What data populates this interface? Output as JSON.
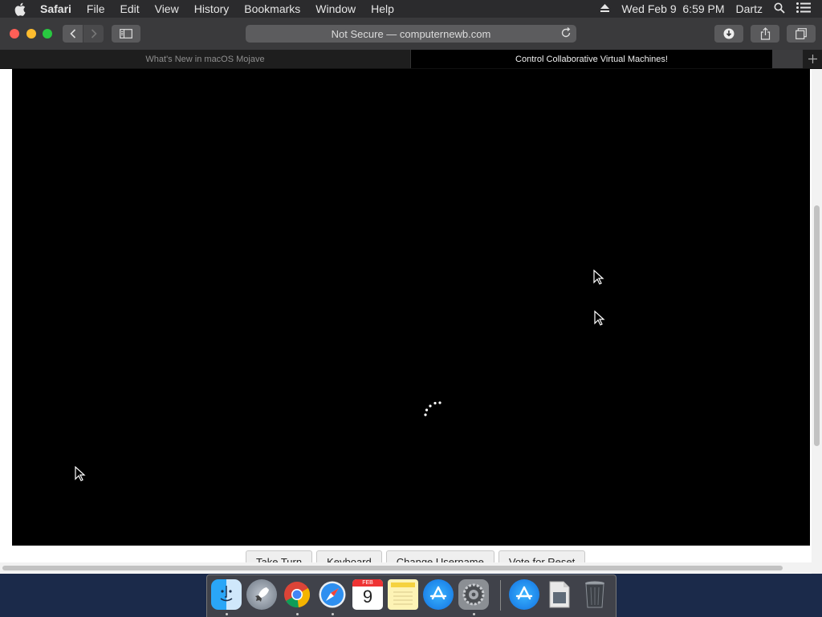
{
  "menubar": {
    "app_name": "Safari",
    "items": [
      "File",
      "Edit",
      "View",
      "History",
      "Bookmarks",
      "Window",
      "Help"
    ],
    "clock": "Wed Feb 9  6:59 PM",
    "user": "Dartz"
  },
  "toolbar": {
    "address": "Not Secure — computernewb.com"
  },
  "tabs": [
    {
      "label": "What's New in macOS Mojave"
    },
    {
      "label": "Control Collaborative Virtual Machines!"
    }
  ],
  "vm_controls": [
    {
      "label": "Take Turn"
    },
    {
      "label": "Keyboard"
    },
    {
      "label": "Change Username"
    },
    {
      "label": "Vote for Reset"
    }
  ],
  "dock": {
    "calendar": {
      "month": "FEB",
      "day": "9"
    },
    "apps": [
      "finder-icon",
      "launchpad-icon",
      "chrome-icon",
      "safari-icon",
      "calendar-icon",
      "notes-icon",
      "app-store-icon",
      "system-preferences-icon",
      "app-store-installer-icon",
      "document-icon",
      "trash-icon"
    ]
  },
  "colors": {
    "menubar": "#2b2b2d",
    "toolbar": "#3a3a3c",
    "close": "#fe5f57",
    "minimize": "#febc2e",
    "zoom": "#28c840",
    "vm_background": "#000000"
  }
}
